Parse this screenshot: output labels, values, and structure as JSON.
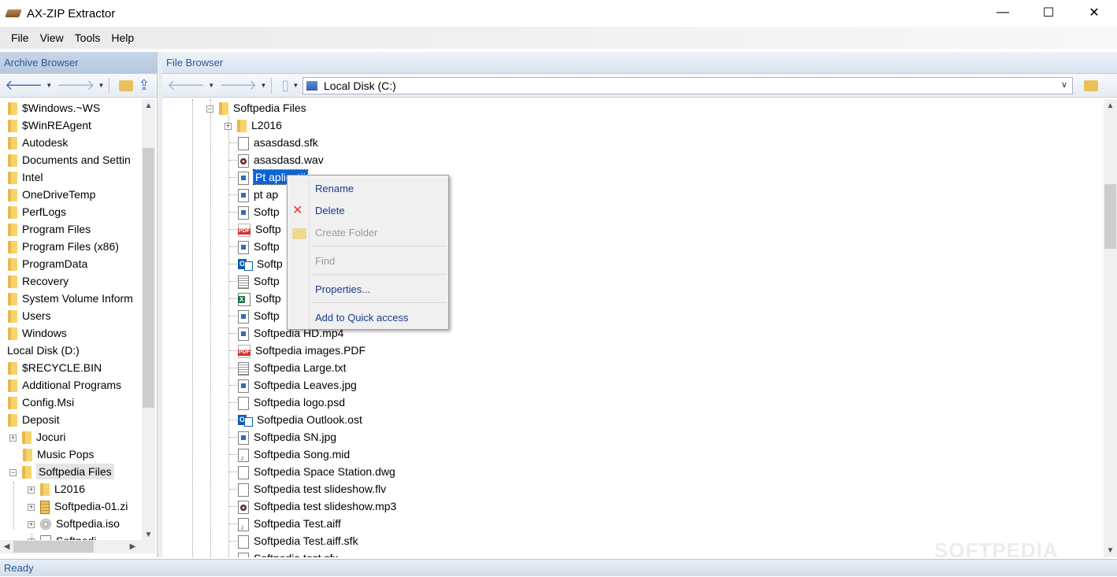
{
  "window": {
    "title": "AX-ZIP Extractor",
    "minimize": "—",
    "maximize": "☐",
    "close": "✕"
  },
  "menu": [
    "File",
    "View",
    "Tools",
    "Help"
  ],
  "archive_browser": {
    "header": "Archive Browser",
    "items": [
      {
        "label": "$Windows.~WS",
        "type": "folder"
      },
      {
        "label": "$WinREAgent",
        "type": "folder"
      },
      {
        "label": "Autodesk",
        "type": "folder"
      },
      {
        "label": "Documents and Settin",
        "type": "folder"
      },
      {
        "label": "Intel",
        "type": "folder"
      },
      {
        "label": "OneDriveTemp",
        "type": "folder"
      },
      {
        "label": "PerfLogs",
        "type": "folder"
      },
      {
        "label": "Program Files",
        "type": "folder"
      },
      {
        "label": "Program Files (x86)",
        "type": "folder"
      },
      {
        "label": "ProgramData",
        "type": "folder"
      },
      {
        "label": "Recovery",
        "type": "folder"
      },
      {
        "label": "System Volume Inform",
        "type": "folder"
      },
      {
        "label": "Users",
        "type": "folder"
      },
      {
        "label": "Windows",
        "type": "folder"
      },
      {
        "label": "Local Disk (D:)",
        "type": "drive"
      },
      {
        "label": "$RECYCLE.BIN",
        "type": "folder"
      },
      {
        "label": "Additional Programs",
        "type": "folder"
      },
      {
        "label": "Config.Msi",
        "type": "folder"
      },
      {
        "label": "Deposit",
        "type": "folder"
      },
      {
        "label": "Jocuri",
        "type": "folder-sub"
      },
      {
        "label": "Music Pops",
        "type": "folder-sub"
      },
      {
        "label": "Softpedia Files",
        "type": "folder-sub"
      },
      {
        "label": "L2016",
        "type": "folder-sub2"
      },
      {
        "label": "Softpedia-01.zi",
        "type": "zip-sub2"
      },
      {
        "label": "Softpedia.iso",
        "type": "iso-sub2"
      },
      {
        "label": "Softpedi",
        "type": "file-sub2"
      }
    ]
  },
  "file_browser": {
    "header": "File Browser",
    "path": "Local Disk (C:)",
    "root": "Softpedia Files",
    "items": [
      {
        "label": "L2016",
        "icon": "folder"
      },
      {
        "label": "asasdasd.sfk",
        "icon": "file"
      },
      {
        "label": "asasdasd.wav",
        "icon": "wav"
      },
      {
        "label": "Pt aplicatii.gif",
        "icon": "img"
      },
      {
        "label": "pt ap",
        "icon": "img"
      },
      {
        "label": "Softp",
        "icon": "img"
      },
      {
        "label": "Softp",
        "icon": "pdf"
      },
      {
        "label": "Softp",
        "icon": "img"
      },
      {
        "label": "Softp",
        "icon": "outlook"
      },
      {
        "label": "Softp",
        "icon": "txt"
      },
      {
        "label": "Softp",
        "icon": "xls"
      },
      {
        "label": "Softp",
        "icon": "img"
      },
      {
        "label": "Softpedia HD.mp4",
        "icon": "img"
      },
      {
        "label": "Softpedia images.PDF",
        "icon": "pdf"
      },
      {
        "label": "Softpedia Large.txt",
        "icon": "txt"
      },
      {
        "label": "Softpedia Leaves.jpg",
        "icon": "img"
      },
      {
        "label": "Softpedia logo.psd",
        "icon": "file"
      },
      {
        "label": "Softpedia Outlook.ost",
        "icon": "outlook"
      },
      {
        "label": "Softpedia SN.jpg",
        "icon": "img"
      },
      {
        "label": "Softpedia Song.mid",
        "icon": "mid"
      },
      {
        "label": "Softpedia Space Station.dwg",
        "icon": "file"
      },
      {
        "label": "Softpedia test slideshow.flv",
        "icon": "file"
      },
      {
        "label": "Softpedia test slideshow.mp3",
        "icon": "wav"
      },
      {
        "label": "Softpedia Test.aiff",
        "icon": "mid"
      },
      {
        "label": "Softpedia Test.aiff.sfk",
        "icon": "file"
      },
      {
        "label": "Softpedia test.sfx",
        "icon": "file"
      }
    ],
    "selected_label": "Pt aplicatii"
  },
  "context_menu": {
    "rename": "Rename",
    "delete": "Delete",
    "create_folder": "Create Folder",
    "find": "Find",
    "properties": "Properties...",
    "quick_access": "Add to Quick access"
  },
  "status": "Ready",
  "watermark": "SOFTPEDIA",
  "colors": {
    "accent": "#2b5797",
    "selection": "#0a64d8",
    "delete_icon": "#e03b3b"
  }
}
